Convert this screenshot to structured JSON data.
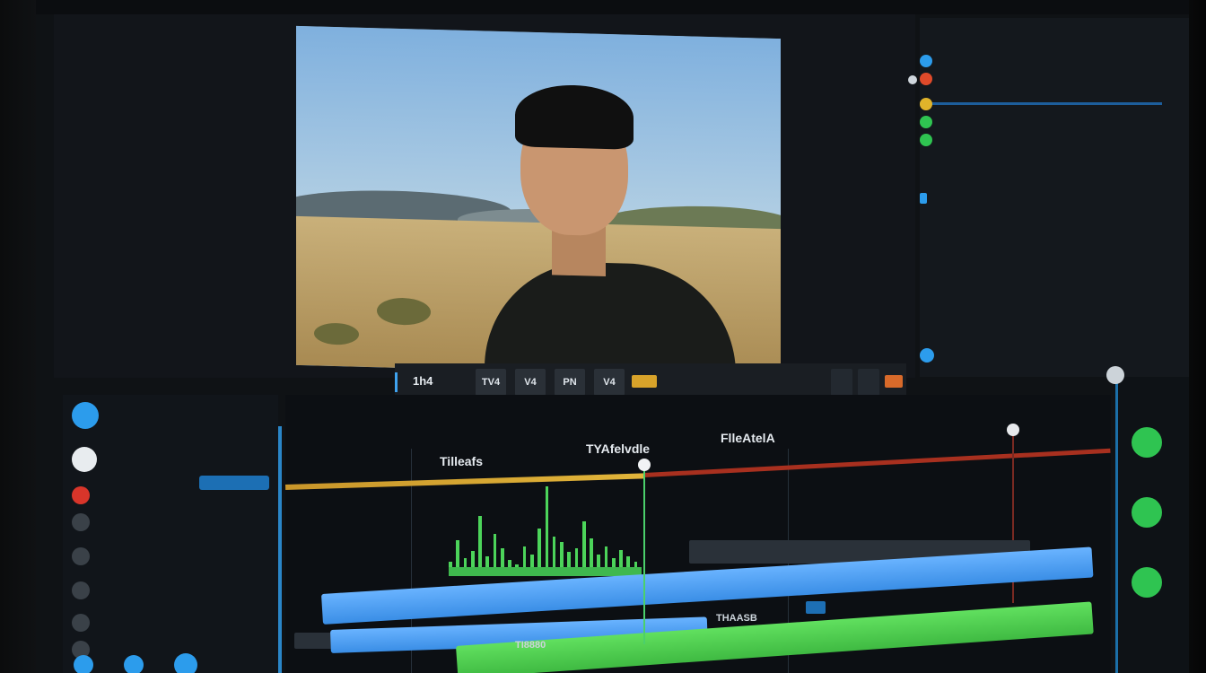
{
  "topbar": {
    "menus": [
      "",
      "",
      "",
      ""
    ]
  },
  "viewer": {
    "caption": "",
    "timecode": "",
    "labels": [
      "",
      "",
      "",
      ""
    ]
  },
  "transport": {
    "timecode": "1h4",
    "buttons": [
      "TV4",
      "V4",
      "PN",
      "V4",
      ""
    ]
  },
  "right_panel": {
    "items": [
      {
        "color": "#2c9cec",
        "label": "",
        "value": ""
      },
      {
        "color": "#e04a2a",
        "label": "",
        "value": ""
      },
      {
        "color": "#e0b32a",
        "label": "",
        "value": ""
      },
      {
        "color": "#2fc451",
        "label": "",
        "value": ""
      },
      {
        "color": "#2fc451",
        "label": "",
        "value": ""
      },
      {
        "color": "",
        "label": "",
        "value": ""
      },
      {
        "color": "#2c9cec",
        "label": "",
        "value": ""
      },
      {
        "color": "",
        "label": "",
        "value": ""
      }
    ]
  },
  "left_panel": {
    "rows": [
      {
        "color": "#2c9cec",
        "label": "",
        "right": ""
      },
      {
        "color": "#e8ecef",
        "label": "",
        "right": ""
      },
      {
        "color": "#d8352a",
        "label": "",
        "right": ""
      },
      {
        "color": "#3a4148",
        "label": "",
        "right": ""
      },
      {
        "color": "#3a4148",
        "label": "",
        "right": ""
      },
      {
        "color": "#3a4148",
        "label": "",
        "right": ""
      },
      {
        "color": "#3a4148",
        "label": "",
        "right": ""
      },
      {
        "color": "#3a4148",
        "label": "",
        "right": ""
      }
    ]
  },
  "timeline": {
    "labels": [
      "Tilleafs",
      "TYAfelvdle",
      "FlleAtelA"
    ],
    "track_labels": [
      "THAASB",
      "TI8880"
    ],
    "playhead_percent": 42,
    "clip_colors": {
      "blue": "#4fa3f5",
      "green": "#4fcf54",
      "yellow": "#e0b32a",
      "red": "#a8301f"
    },
    "waveform": [
      14,
      36,
      18,
      25,
      60,
      20,
      42,
      28,
      16,
      12,
      30,
      22,
      48,
      90,
      40,
      34,
      24,
      28,
      55,
      38,
      22,
      30,
      18,
      26,
      20,
      14
    ]
  },
  "icons": {
    "play_marker": "playhead-icon",
    "record_toggle": "record-icon"
  }
}
